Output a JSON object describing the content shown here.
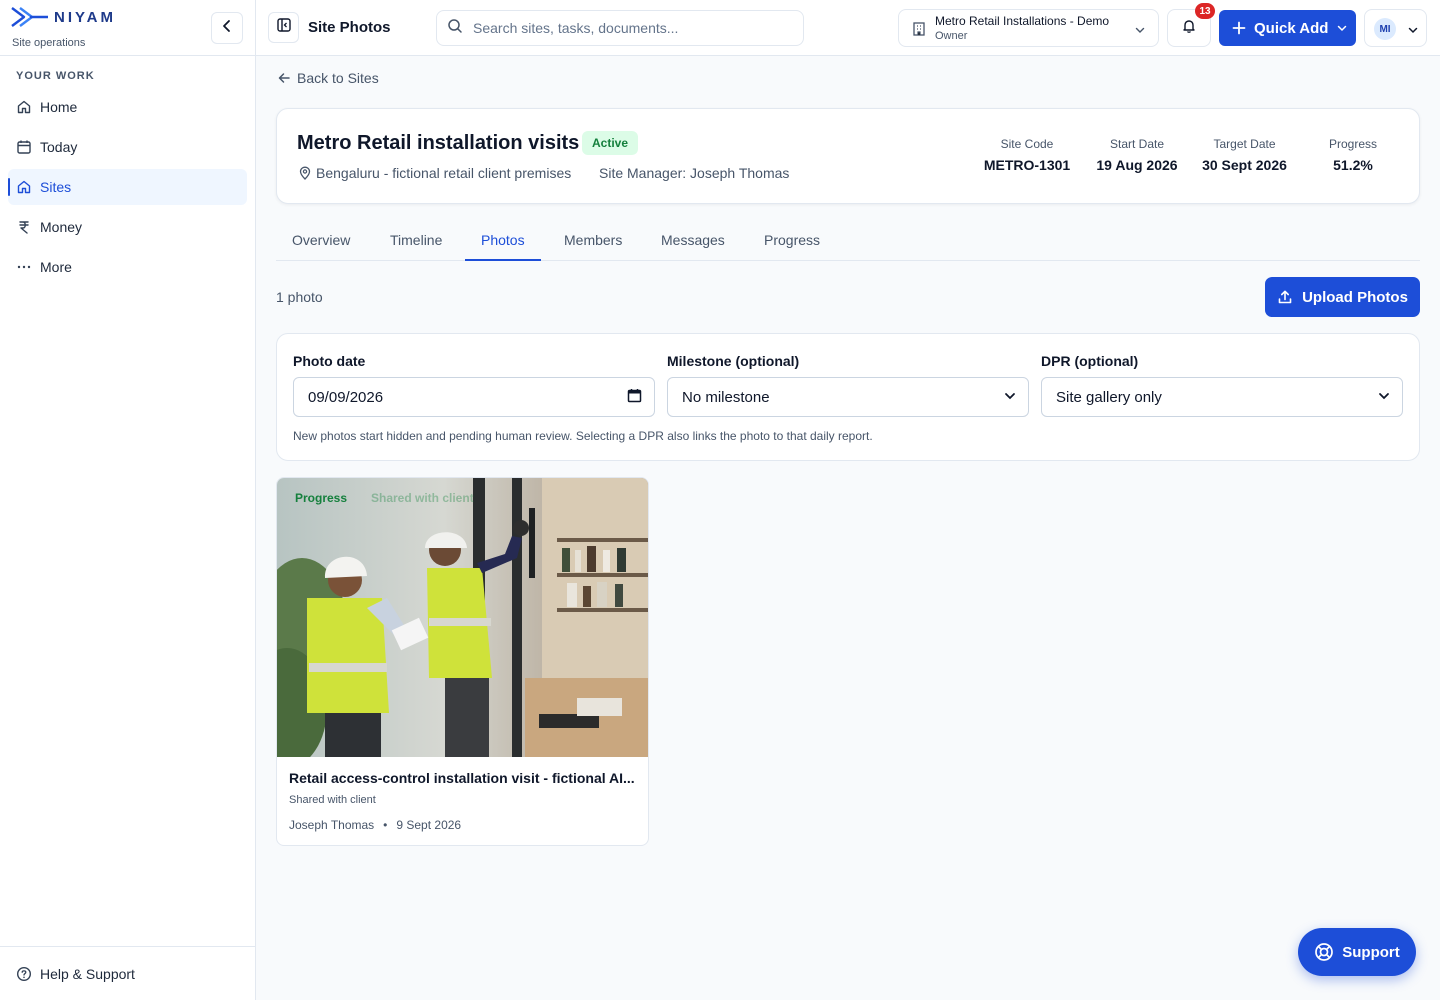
{
  "brand": {
    "name": "NIYAM",
    "subtitle": "Site operations"
  },
  "sidebar": {
    "section_label": "YOUR WORK",
    "items": [
      {
        "label": "Home",
        "icon": "home-icon"
      },
      {
        "label": "Today",
        "icon": "calendar-icon"
      },
      {
        "label": "Sites",
        "icon": "home-icon",
        "active": true
      },
      {
        "label": "Money",
        "icon": "rupee-icon"
      },
      {
        "label": "More",
        "icon": "more-icon"
      }
    ],
    "footer": "Help & Support"
  },
  "topbar": {
    "title": "Site Photos",
    "search_placeholder": "Search sites, tasks, documents...",
    "org": {
      "name": "Metro Retail Installations - Demo",
      "role": "Owner"
    },
    "notification_count": "13",
    "quick_add_label": "Quick Add",
    "user_initials": "MI"
  },
  "back_link": "Back to Sites",
  "site": {
    "name": "Metro Retail installation visits",
    "status": "Active",
    "location": "Bengaluru - fictional retail client premises",
    "manager": "Site Manager: Joseph Thomas",
    "stats": [
      {
        "label": "Site Code",
        "value": "METRO-1301"
      },
      {
        "label": "Start Date",
        "value": "19 Aug 2026"
      },
      {
        "label": "Target Date",
        "value": "30 Sept 2026"
      },
      {
        "label": "Progress",
        "value": "51.2%"
      }
    ]
  },
  "tabs": [
    "Overview",
    "Timeline",
    "Photos",
    "Members",
    "Messages",
    "Progress"
  ],
  "active_tab": "Photos",
  "photos": {
    "count_label": "1 photo",
    "upload_label": "Upload Photos",
    "form": {
      "date_label": "Photo date",
      "date_value": "09/09/2026",
      "milestone_label": "Milestone (optional)",
      "milestone_value": "No milestone",
      "dpr_label": "DPR (optional)",
      "dpr_value": "Site gallery only",
      "hint": "New photos start hidden and pending human review. Selecting a DPR also links the photo to that daily report."
    },
    "items": [
      {
        "tag": "Progress",
        "tag_secondary": "Shared with client",
        "title": "Retail access-control installation visit - fictional AI...",
        "shared": "Shared with client",
        "author": "Joseph Thomas",
        "date": "9 Sept 2026"
      }
    ]
  },
  "support_label": "Support",
  "colors": {
    "accent": "#1d4ed8",
    "success": "#15803d",
    "danger": "#dc2626"
  }
}
